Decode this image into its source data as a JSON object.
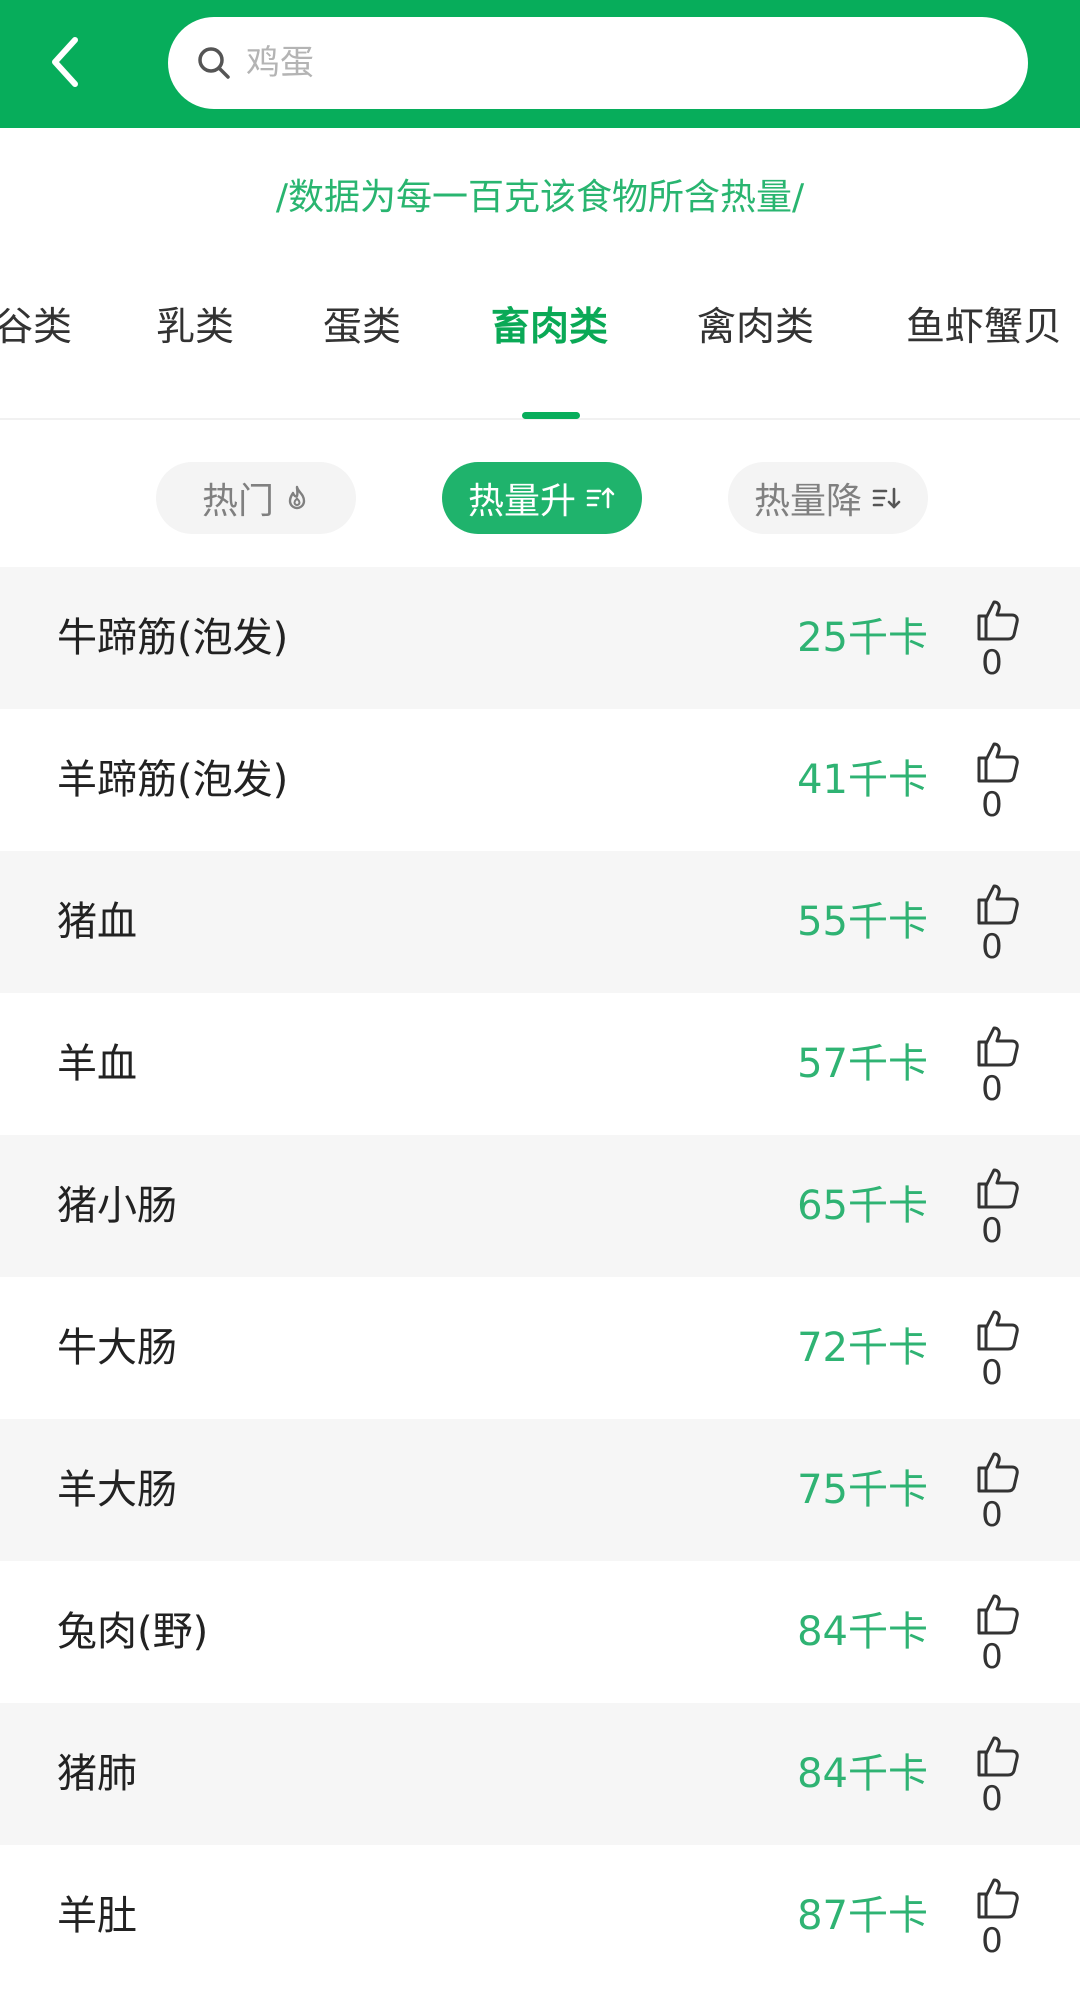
{
  "header": {
    "search_placeholder": "鸡蛋"
  },
  "notice": "/数据为每一百克该食物所含热量/",
  "categories": [
    {
      "label": "谷类",
      "active": false
    },
    {
      "label": "乳类",
      "active": false
    },
    {
      "label": "蛋类",
      "active": false
    },
    {
      "label": "畜肉类",
      "active": true
    },
    {
      "label": "禽肉类",
      "active": false
    },
    {
      "label": "鱼虾蟹贝",
      "active": false
    }
  ],
  "sort": {
    "hot_label": "热门",
    "asc_label": "热量升",
    "desc_label": "热量降",
    "selected": "asc"
  },
  "foods": [
    {
      "name": "牛蹄筋(泡发)",
      "calories": "25千卡",
      "likes": "0"
    },
    {
      "name": "羊蹄筋(泡发)",
      "calories": "41千卡",
      "likes": "0"
    },
    {
      "name": "猪血",
      "calories": "55千卡",
      "likes": "0"
    },
    {
      "name": "羊血",
      "calories": "57千卡",
      "likes": "0"
    },
    {
      "name": "猪小肠",
      "calories": "65千卡",
      "likes": "0"
    },
    {
      "name": "牛大肠",
      "calories": "72千卡",
      "likes": "0"
    },
    {
      "name": "羊大肠",
      "calories": "75千卡",
      "likes": "0"
    },
    {
      "name": "兔肉(野)",
      "calories": "84千卡",
      "likes": "0"
    },
    {
      "name": "猪肺",
      "calories": "84千卡",
      "likes": "0"
    },
    {
      "name": "羊肚",
      "calories": "87千卡",
      "likes": "0"
    }
  ],
  "colors": {
    "brand_green": "#07ad5b",
    "calorie_green": "#2fb373",
    "row_alt": "#f6f6f6"
  }
}
